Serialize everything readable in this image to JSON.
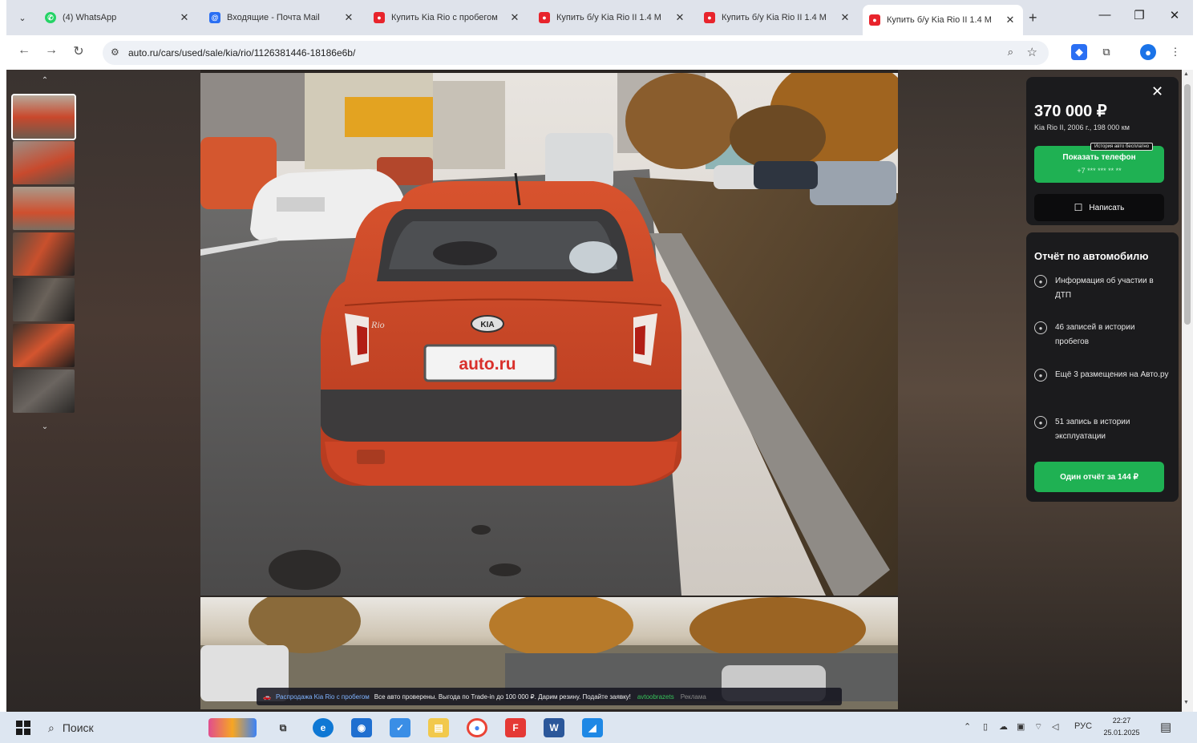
{
  "browser": {
    "tabs": [
      {
        "title": "(4) WhatsApp",
        "color": "#25d366",
        "glyph": "W"
      },
      {
        "title": "Входящие - Почта Mail",
        "color": "#2a6ff3",
        "glyph": "@"
      },
      {
        "title": "Купить Kia Rio с пробегом",
        "color": "#e8242c",
        "glyph": "▣"
      },
      {
        "title": "Купить б/у Kia Rio II 1.4 М",
        "color": "#e8242c",
        "glyph": "▣"
      },
      {
        "title": "Купить б/у Kia Rio II 1.4 М",
        "color": "#e8242c",
        "glyph": "▣"
      },
      {
        "title": "Купить б/у Kia Rio II 1.4 М",
        "color": "#e8242c",
        "glyph": "▣"
      }
    ],
    "url": "auto.ru/cars/used/sale/kia/rio/1126381446-18186e6b/"
  },
  "listing": {
    "price": "370 000 ₽",
    "subtitle": "Kia Rio II, 2006 г., 198 000 км",
    "show_phone": "Показать телефон",
    "phone_masked": "+7 *** *** ** **",
    "free_badge": "История авто бесплатно",
    "write_button": "Написать",
    "photo_count": 7
  },
  "report": {
    "title": "Отчёт по автомобилю",
    "items": [
      "Информация об участии в ДТП",
      "46 записей в истории пробегов",
      "Ещё 3 размещения на Авто.ру",
      "51 запись в истории эксплуатации"
    ],
    "button": "Один отчёт за 144 ₽"
  },
  "banner": {
    "text_blue": "Распродажа Kia Rio с пробегом",
    "text_main": "Все авто проверены. Выгода по Trade-in до 100 000 ₽. Дарим резину. Подайте заявку!",
    "text_green": "avtoobrazets",
    "text_grey": "Реклама"
  },
  "taskbar": {
    "search_label": "Поиск",
    "lang": "РУС",
    "time": "22:27",
    "date": "25.01.2025"
  }
}
